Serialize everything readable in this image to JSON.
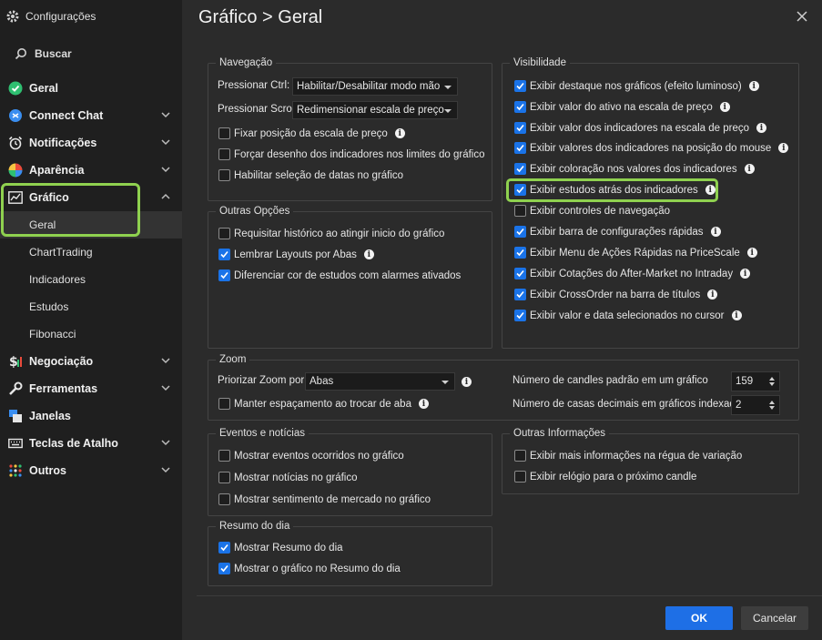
{
  "window_title": "Configurações",
  "search_label": "Buscar",
  "nav": {
    "geral": "Geral",
    "connect_chat": "Connect Chat",
    "notificacoes": "Notificações",
    "aparencia": "Aparência",
    "grafico": "Gráfico",
    "grafico_sub": [
      "Geral",
      "ChartTrading",
      "Indicadores",
      "Estudos",
      "Fibonacci"
    ],
    "negociacao": "Negociação",
    "ferramentas": "Ferramentas",
    "janelas": "Janelas",
    "teclas": "Teclas de Atalho",
    "outros": "Outros"
  },
  "page_title": "Gráfico > Geral",
  "navegacao": {
    "legend": "Navegação",
    "ctrl_label": "Pressionar Ctrl:",
    "ctrl_value": "Habilitar/Desabilitar modo mão",
    "scroll_label": "Pressionar Scroll:",
    "scroll_value": "Redimensionar escala de preço",
    "checks": [
      {
        "label": "Fixar posição da escala de preço",
        "checked": false
      },
      {
        "label": "Forçar desenho dos indicadores nos limites do gráfico",
        "checked": false
      },
      {
        "label": "Habilitar seleção de datas no gráfico",
        "checked": false
      }
    ]
  },
  "outras_opcoes": {
    "legend": "Outras Opções",
    "checks": [
      {
        "label": "Requisitar histórico ao atingir inicio do gráfico",
        "checked": false
      },
      {
        "label": "Lembrar Layouts por Abas",
        "checked": true
      },
      {
        "label": "Diferenciar cor de estudos com alarmes ativados",
        "checked": true
      }
    ]
  },
  "visibilidade": {
    "legend": "Visibilidade",
    "checks": [
      {
        "label": "Exibir destaque nos gráficos (efeito luminoso)",
        "checked": true
      },
      {
        "label": "Exibir valor do ativo na escala de preço",
        "checked": true
      },
      {
        "label": "Exibir valor dos indicadores na escala de preço",
        "checked": true
      },
      {
        "label": "Exibir valores dos indicadores na posição do mouse",
        "checked": true
      },
      {
        "label": "Exibir coloração nos valores dos indicadores",
        "checked": true
      },
      {
        "label": "Exibir estudos atrás dos indicadores",
        "checked": true
      },
      {
        "label": "Exibir controles de navegação",
        "checked": false
      },
      {
        "label": "Exibir barra de configurações rápidas",
        "checked": true
      },
      {
        "label": "Exibir Menu de Ações Rápidas na PriceScale",
        "checked": true
      },
      {
        "label": "Exibir Cotações do After-Market no Intraday",
        "checked": true
      },
      {
        "label": "Exibir CrossOrder na barra de títulos",
        "checked": true
      },
      {
        "label": "Exibir valor e data selecionados no cursor",
        "checked": true
      }
    ]
  },
  "zoom": {
    "legend": "Zoom",
    "priorizar_label": "Priorizar Zoom por:",
    "priorizar_value": "Abas",
    "manter_label": "Manter espaçamento ao trocar de aba",
    "manter_checked": false,
    "candles_label": "Número de candles padrão em um gráfico",
    "candles_value": "159",
    "casas_label": "Número de casas decimais em gráficos indexados",
    "casas_value": "2"
  },
  "eventos": {
    "legend": "Eventos e notícias",
    "checks": [
      {
        "label": "Mostrar eventos ocorridos no gráfico",
        "checked": false
      },
      {
        "label": "Mostrar notícias no gráfico",
        "checked": false
      },
      {
        "label": "Mostrar sentimento de mercado no gráfico",
        "checked": false
      }
    ]
  },
  "outras_info": {
    "legend": "Outras Informações",
    "checks": [
      {
        "label": "Exibir mais informações na régua de variação",
        "checked": false
      },
      {
        "label": "Exibir relógio para o próximo candle",
        "checked": false
      }
    ]
  },
  "resumo": {
    "legend": "Resumo do dia",
    "checks": [
      {
        "label": "Mostrar Resumo do dia",
        "checked": true
      },
      {
        "label": "Mostrar o gráfico no Resumo do dia",
        "checked": true
      }
    ]
  },
  "buttons": {
    "ok": "OK",
    "cancel": "Cancelar"
  },
  "colors": {
    "accent": "#1e6fe6",
    "highlight": "#8fd14f",
    "sidebar_bg": "#1f1f1f",
    "main_bg": "#2b2b2b"
  }
}
